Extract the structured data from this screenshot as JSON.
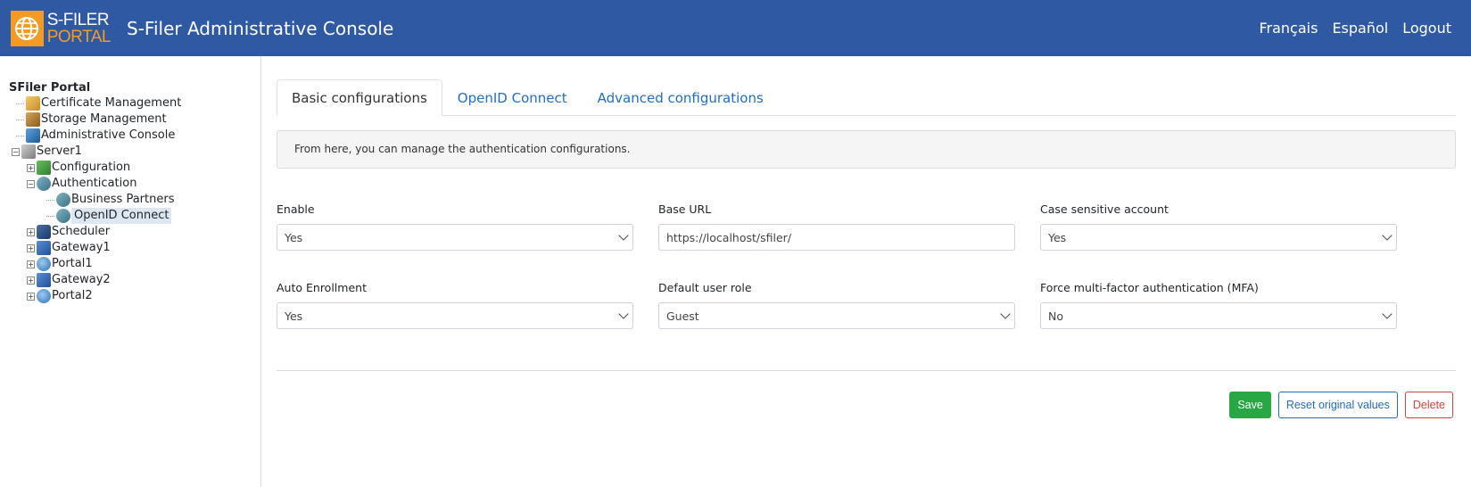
{
  "header": {
    "logo_line1": "S-FILER",
    "logo_line2": "PORTAL",
    "title": "S-Filer Administrative Console",
    "links": [
      "Français",
      "Español",
      "Logout"
    ]
  },
  "tree": {
    "root": "SFiler Portal",
    "items": [
      {
        "label": "Certificate Management",
        "icon": "certificate-icon"
      },
      {
        "label": "Storage Management",
        "icon": "storage-icon"
      },
      {
        "label": "Administrative Console",
        "icon": "admin-console-icon"
      },
      {
        "label": "Server1",
        "icon": "server-icon"
      },
      {
        "label": "Configuration",
        "icon": "configuration-icon"
      },
      {
        "label": "Authentication",
        "icon": "authentication-icon"
      },
      {
        "label": "Business Partners",
        "icon": "users-icon"
      },
      {
        "label": "OpenID Connect",
        "icon": "users-icon"
      },
      {
        "label": "Scheduler",
        "icon": "scheduler-icon"
      },
      {
        "label": "Gateway1",
        "icon": "gateway-icon"
      },
      {
        "label": "Portal1",
        "icon": "portal-icon"
      },
      {
        "label": "Gateway2",
        "icon": "gateway-icon"
      },
      {
        "label": "Portal2",
        "icon": "portal-icon"
      }
    ]
  },
  "tabs": [
    "Basic configurations",
    "OpenID Connect",
    "Advanced configurations"
  ],
  "info": "From here, you can manage the authentication configurations.",
  "fields": {
    "enable": {
      "label": "Enable",
      "value": "Yes"
    },
    "base_url": {
      "label": "Base URL",
      "value": "https://localhost/sfiler/"
    },
    "case_sensitive": {
      "label": "Case sensitive account",
      "value": "Yes"
    },
    "auto_enrollment": {
      "label": "Auto Enrollment",
      "value": "Yes"
    },
    "default_role": {
      "label": "Default user role",
      "value": "Guest"
    },
    "force_mfa": {
      "label": "Force multi-factor authentication (MFA)",
      "value": "No"
    }
  },
  "buttons": {
    "save": "Save",
    "reset": "Reset original values",
    "delete": "Delete"
  }
}
